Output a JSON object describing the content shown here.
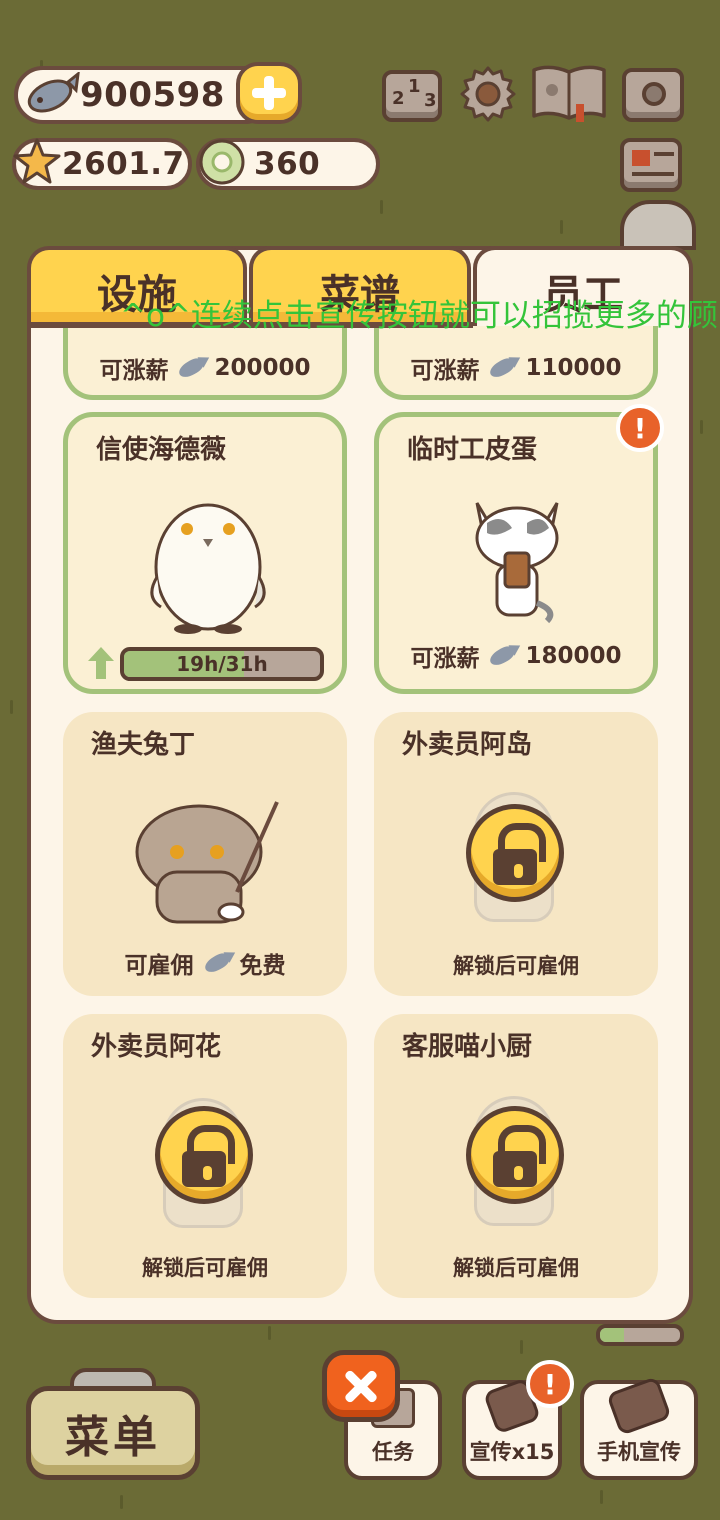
{
  "currency": {
    "fish": "900598",
    "stars": "2601.7",
    "coins": "360"
  },
  "tabs": [
    {
      "label": "设施"
    },
    {
      "label": "菜谱"
    },
    {
      "label": "员工"
    }
  ],
  "toast": "^o^连续点击宣传按钮就可以招揽更多的顾",
  "top_cards": [
    {
      "action": "可涨薪",
      "value": "200000"
    },
    {
      "action": "可涨薪",
      "value": "110000"
    }
  ],
  "staff": [
    {
      "name": "信使海德薇",
      "progress_text": "19h/31h",
      "progress": 0.61
    },
    {
      "name": "临时工皮蛋",
      "action": "可涨薪",
      "value": "180000",
      "alert": "!"
    },
    {
      "name": "渔夫兔丁",
      "action": "可雇佣",
      "value": "免费"
    },
    {
      "name": "外卖员阿岛",
      "locked": "解锁后可雇佣"
    },
    {
      "name": "外卖员阿花",
      "locked": "解锁后可雇佣"
    },
    {
      "name": "客服喵小厨",
      "locked": "解锁后可雇佣"
    }
  ],
  "bottom": {
    "menu": "菜单",
    "task": "任务",
    "promo": "宣传x15",
    "phone_promo": "手机宣传",
    "promo_alert": "!"
  },
  "colors": {
    "background": "#6b6b36",
    "panel": "#fdf5e8",
    "accent": "#ffd34e",
    "border": "#6b4b3e",
    "green_outline": "#a3c27a",
    "alert": "#e8622a",
    "toast": "#34c43a"
  }
}
